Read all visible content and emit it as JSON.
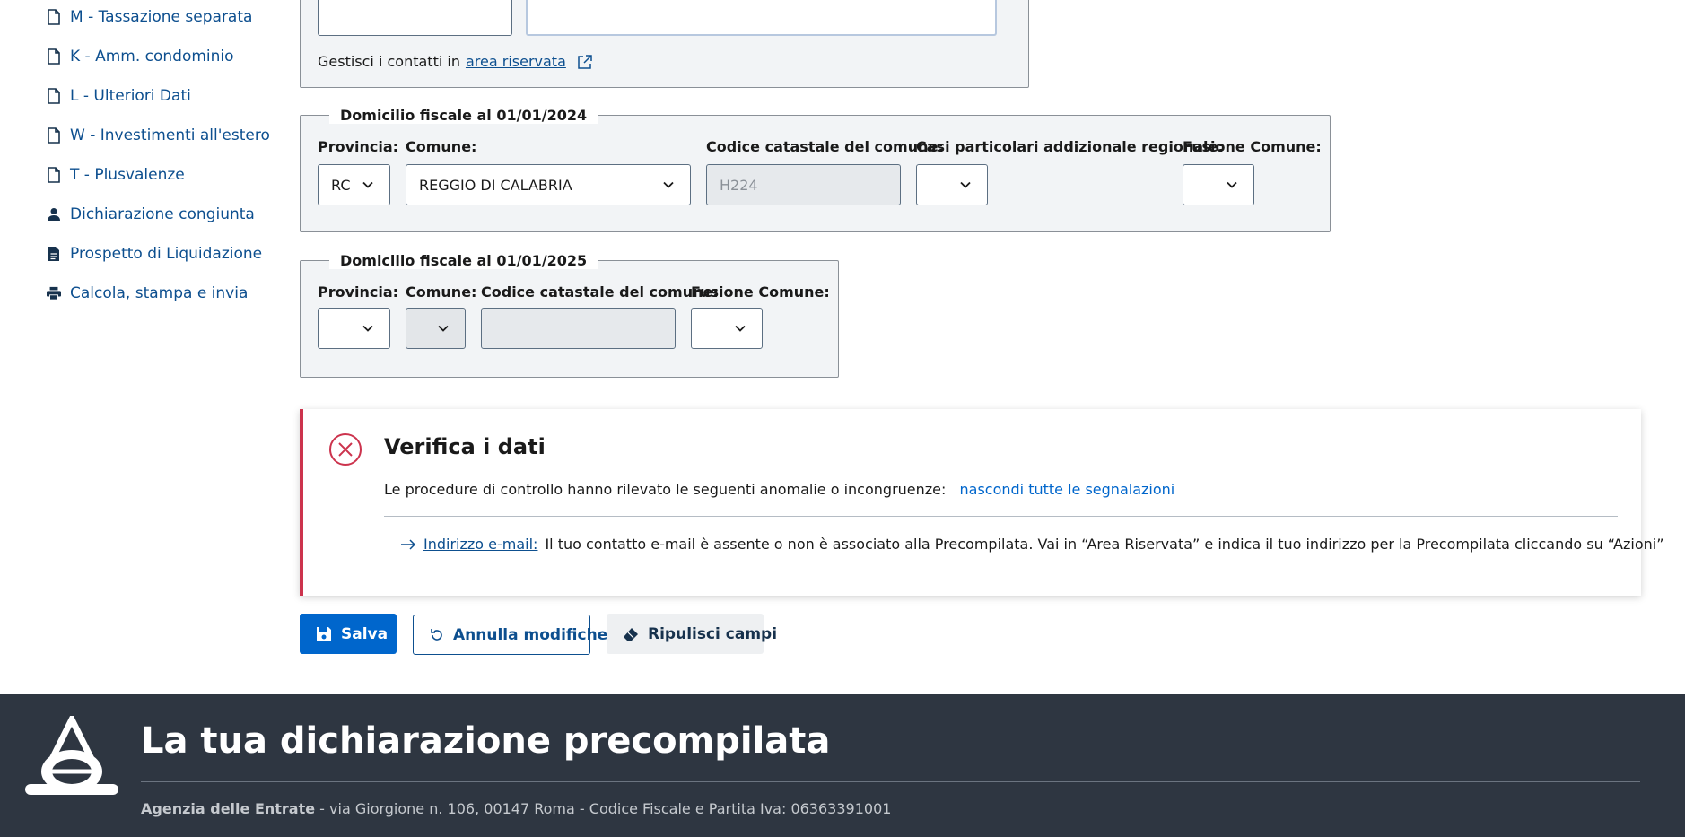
{
  "sidebar": {
    "items": [
      {
        "label": "M - Tassazione separata",
        "icon": "document-icon"
      },
      {
        "label": "K - Amm. condominio",
        "icon": "document-icon"
      },
      {
        "label": "L - Ulteriori Dati",
        "icon": "document-icon"
      },
      {
        "label": "W - Investimenti all'estero",
        "icon": "document-icon"
      },
      {
        "label": "T - Plusvalenze",
        "icon": "document-icon"
      },
      {
        "label": "Dichiarazione congiunta",
        "icon": "person-icon"
      },
      {
        "label": "Prospetto di Liquidazione",
        "icon": "document-filled-icon"
      },
      {
        "label": "Calcola, stampa e invia",
        "icon": "printer-icon"
      }
    ]
  },
  "contacts": {
    "text": "Gestisci i contatti in",
    "link": "area riservata"
  },
  "domicilio2024": {
    "legend": "Domicilio fiscale al 01/01/2024",
    "provincia_label": "Provincia:",
    "provincia_value": "RC",
    "comune_label": "Comune:",
    "comune_value": "REGGIO DI CALABRIA",
    "codice_label": "Codice catastale del comune:",
    "codice_value": "H224",
    "casi_label": "Casi particolari addizionale regionale:",
    "casi_value": "",
    "fusione_label": "Fusione Comune:",
    "fusione_value": ""
  },
  "domicilio2025": {
    "legend": "Domicilio fiscale al 01/01/2025",
    "provincia_label": "Provincia:",
    "provincia_value": "",
    "comune_label": "Comune:",
    "comune_value": "",
    "codice_label": "Codice catastale del comune:",
    "codice_value": "",
    "fusione_label": "Fusione Comune:",
    "fusione_value": ""
  },
  "alert": {
    "title": "Verifica i dati",
    "text": "Le procedure di controllo hanno rilevato le seguenti anomalie o incongruenze:",
    "toggle_link": "nascondi tutte le segnalazioni",
    "item_link": "Indirizzo e-mail:",
    "item_text": "Il tuo contatto e-mail è assente o non è associato alla Precompilata. Vai in “Area Riservata” e indica il tuo indirizzo per la Precompilata cliccando su “Azioni”",
    "accent_color": "#cc334d"
  },
  "actions": {
    "save": "Salva",
    "cancel": "Annulla modifiche",
    "clear": "Ripulisci campi"
  },
  "footer": {
    "title": "La tua dichiarazione precompilata",
    "org": "Agenzia delle Entrate",
    "address": " - via Giorgione n. 106, 00147 Roma - Codice Fiscale e Partita Iva: 06363391001"
  }
}
